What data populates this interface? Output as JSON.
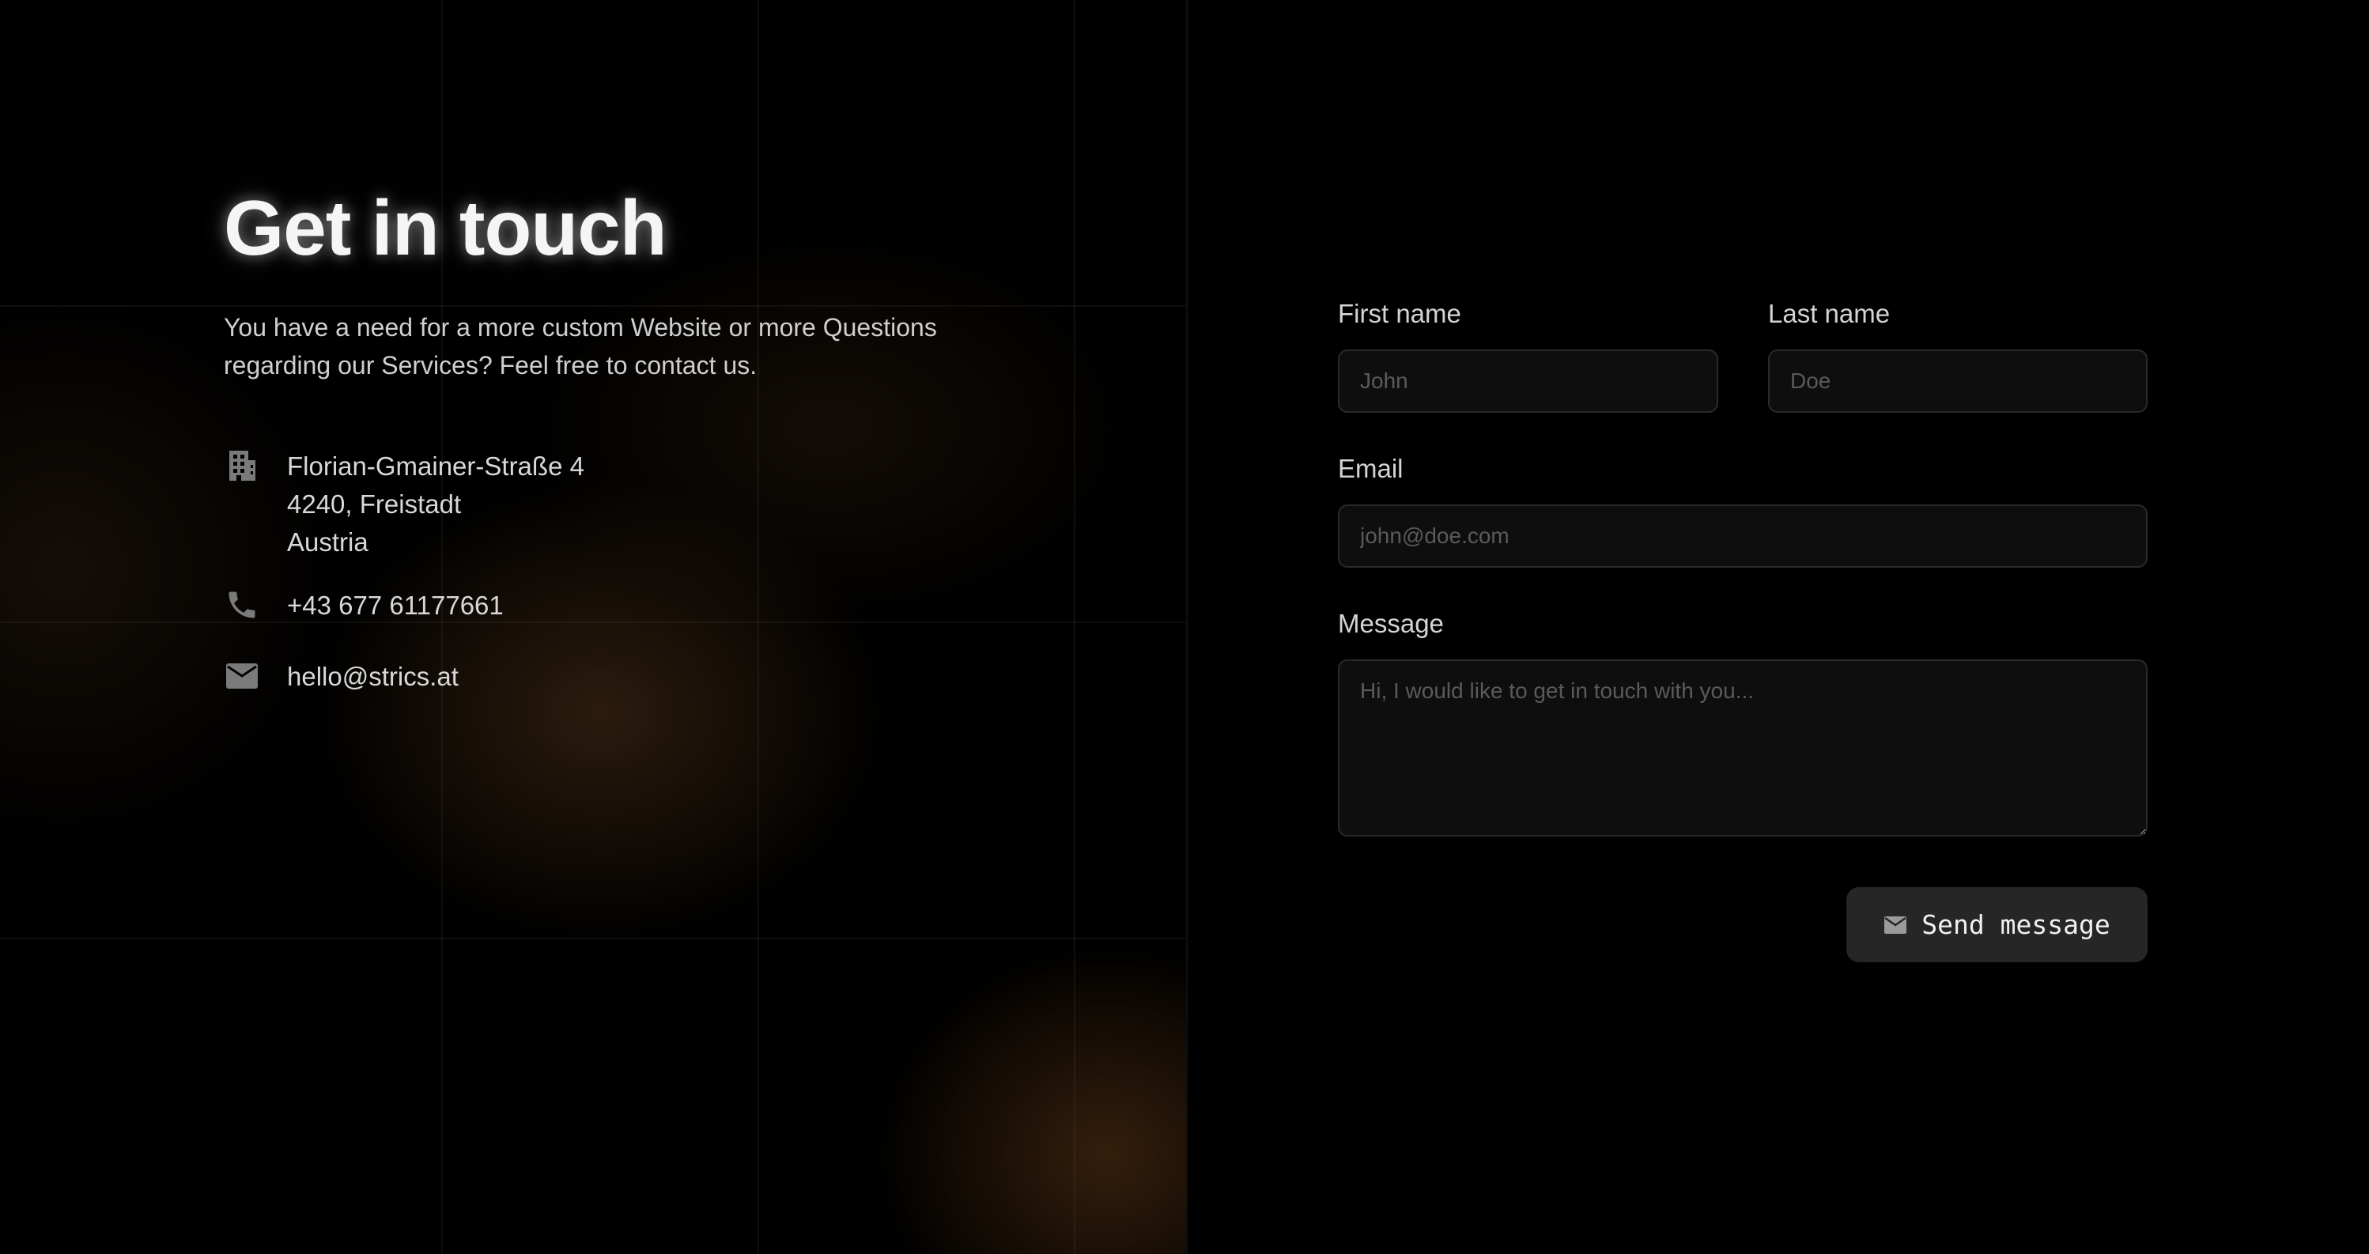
{
  "contact": {
    "title": "Get in touch",
    "subtitle": "You have a need for a more custom Website or more Questions regarding our Services? Feel free to contact us.",
    "address": {
      "icon": "building-icon",
      "line1": "Florian-Gmainer-Straße 4",
      "line2": "4240, Freistadt",
      "line3": "Austria"
    },
    "phone": {
      "icon": "phone-icon",
      "value": "+43 677 61177661"
    },
    "email": {
      "icon": "envelope-icon",
      "value": "hello@strics.at"
    }
  },
  "form": {
    "first_name": {
      "label": "First name",
      "placeholder": "John",
      "value": ""
    },
    "last_name": {
      "label": "Last name",
      "placeholder": "Doe",
      "value": ""
    },
    "email": {
      "label": "Email",
      "placeholder": "john@doe.com",
      "value": ""
    },
    "message": {
      "label": "Message",
      "placeholder": "Hi, I would like to get in touch with you...",
      "value": ""
    },
    "submit": {
      "label": "Send message",
      "icon": "envelope-icon"
    }
  },
  "colors": {
    "background": "#000000",
    "accent_glow": "#4e3218",
    "field_background": "#0e0e0e",
    "field_border": "#2a2a2a",
    "button_background": "#262626"
  }
}
